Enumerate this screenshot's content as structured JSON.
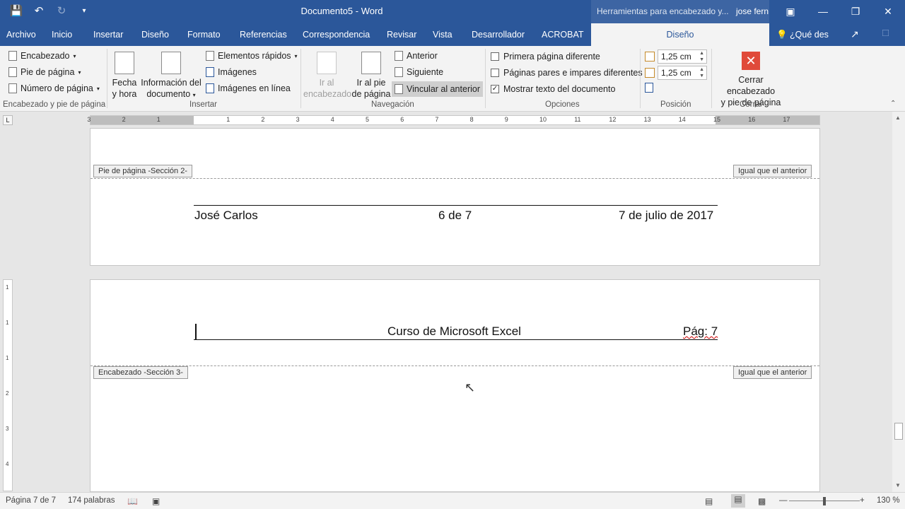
{
  "window": {
    "title": "Documento5  -  Word",
    "context_tools": "Herramientas para encabezado y...",
    "user": "jose fern"
  },
  "tabs": [
    "Archivo",
    "Inicio",
    "Insertar",
    "Diseño",
    "Formato",
    "Referencias",
    "Correspondencia",
    "Revisar",
    "Vista",
    "Desarrollador",
    "ACROBAT"
  ],
  "active_tab": "Diseño",
  "tell_me": "¿Qué des",
  "ribbon": {
    "hf_group": {
      "label": "Encabezado y pie de página",
      "header": "Encabezado",
      "footer": "Pie de página",
      "page_number": "Número de página"
    },
    "insert_group": {
      "label": "Insertar",
      "date_time": [
        "Fecha",
        "y hora"
      ],
      "doc_info": [
        "Información del",
        "documento"
      ],
      "quick_parts": "Elementos rápidos",
      "images": "Imágenes",
      "online_images": "Imágenes en línea"
    },
    "nav_group": {
      "label": "Navegación",
      "goto_header": [
        "Ir al",
        "encabezado"
      ],
      "goto_footer": [
        "Ir al pie",
        "de página"
      ],
      "previous": "Anterior",
      "next": "Siguiente",
      "link_previous": "Vincular al anterior"
    },
    "options_group": {
      "label": "Opciones",
      "different_first": "Primera página diferente",
      "different_odd_even": "Páginas pares e impares diferentes",
      "show_doc_text": "Mostrar texto del documento"
    },
    "position_group": {
      "label": "Posición",
      "header_from_top": "1,25 cm",
      "footer_from_bottom": "1,25 cm"
    },
    "close_group": {
      "label": "Cerrar",
      "close": [
        "Cerrar encabezado",
        "y pie de página"
      ]
    }
  },
  "ruler_numbers": [
    "3",
    "2",
    "1",
    "1",
    "2",
    "3",
    "4",
    "5",
    "6",
    "7",
    "8",
    "9",
    "10",
    "11",
    "12",
    "13",
    "14",
    "15",
    "16",
    "17"
  ],
  "vruler_numbers": [
    "1",
    "1",
    "1",
    "2",
    "3",
    "4"
  ],
  "page6_footer": {
    "tag": "Pie de página -Sección 2-",
    "same_as_previous": "Igual que el anterior",
    "left": "José Carlos",
    "center": "6 de 7",
    "right": "7 de julio de 2017"
  },
  "page7_header": {
    "tag": "Encabezado -Sección 3-",
    "same_as_previous": "Igual que el anterior",
    "center": "Curso de Microsoft Excel",
    "right": "Pág: 7"
  },
  "status": {
    "page": "Página 7 de 7",
    "words": "174 palabras",
    "zoom": "130 %"
  }
}
